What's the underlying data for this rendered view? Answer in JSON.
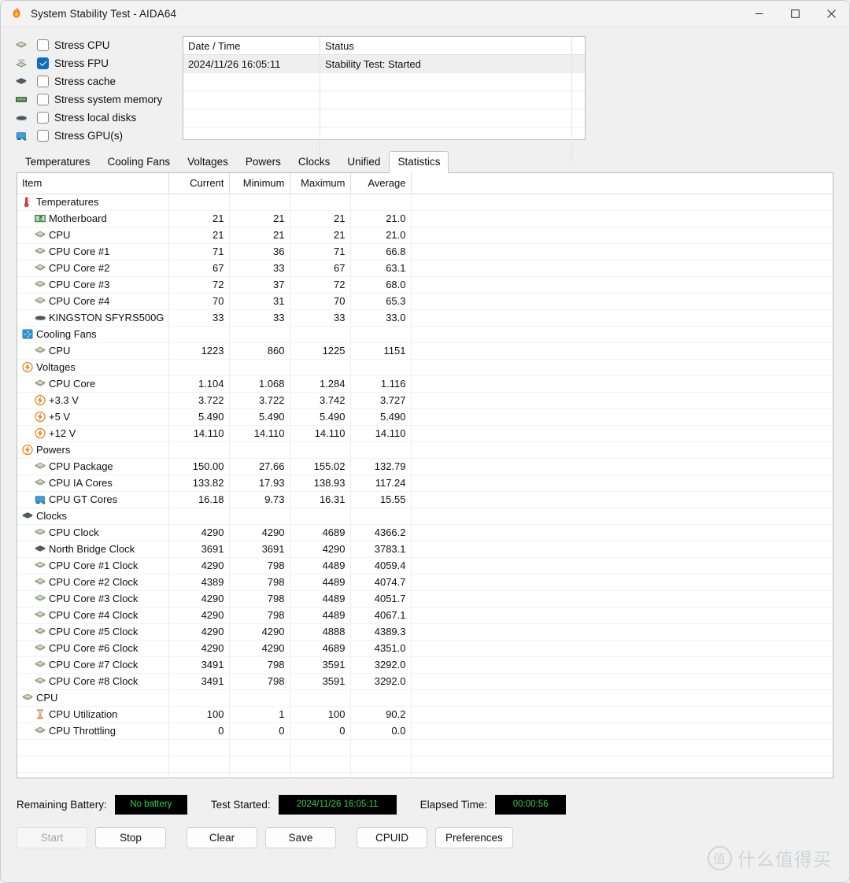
{
  "window": {
    "title": "System Stability Test - AIDA64",
    "app_icon": "flame-icon",
    "minimize_label": "Minimize",
    "maximize_label": "Maximize",
    "close_label": "Close"
  },
  "stress_options": [
    {
      "label": "Stress CPU",
      "checked": false,
      "icon": "cpu-chip-icon"
    },
    {
      "label": "Stress FPU",
      "checked": true,
      "icon": "fpu-chip-icon"
    },
    {
      "label": "Stress cache",
      "checked": false,
      "icon": "cache-chip-icon"
    },
    {
      "label": "Stress system memory",
      "checked": false,
      "icon": "memory-module-icon"
    },
    {
      "label": "Stress local disks",
      "checked": false,
      "icon": "hard-disk-icon"
    },
    {
      "label": "Stress GPU(s)",
      "checked": false,
      "icon": "gpu-monitor-icon"
    }
  ],
  "log": {
    "columns": [
      "Date / Time",
      "Status",
      ""
    ],
    "rows": [
      {
        "datetime": "2024/11/26 16:05:11",
        "status": "Stability Test: Started"
      }
    ]
  },
  "tabs": [
    {
      "label": "Temperatures",
      "active": false
    },
    {
      "label": "Cooling Fans",
      "active": false
    },
    {
      "label": "Voltages",
      "active": false
    },
    {
      "label": "Powers",
      "active": false
    },
    {
      "label": "Clocks",
      "active": false
    },
    {
      "label": "Unified",
      "active": false
    },
    {
      "label": "Statistics",
      "active": true
    }
  ],
  "statistics": {
    "columns": [
      "Item",
      "Current",
      "Minimum",
      "Maximum",
      "Average",
      ""
    ],
    "rows": [
      {
        "type": "group",
        "icon": "thermometer-icon",
        "label": "Temperatures"
      },
      {
        "type": "item",
        "icon": "motherboard-icon",
        "label": "Motherboard",
        "current": "21",
        "minimum": "21",
        "maximum": "21",
        "average": "21.0"
      },
      {
        "type": "item",
        "icon": "cpu-chip-icon",
        "label": "CPU",
        "current": "21",
        "minimum": "21",
        "maximum": "21",
        "average": "21.0"
      },
      {
        "type": "item",
        "icon": "cpu-chip-icon",
        "label": "CPU Core #1",
        "current": "71",
        "minimum": "36",
        "maximum": "71",
        "average": "66.8"
      },
      {
        "type": "item",
        "icon": "cpu-chip-icon",
        "label": "CPU Core #2",
        "current": "67",
        "minimum": "33",
        "maximum": "67",
        "average": "63.1"
      },
      {
        "type": "item",
        "icon": "cpu-chip-icon",
        "label": "CPU Core #3",
        "current": "72",
        "minimum": "37",
        "maximum": "72",
        "average": "68.0"
      },
      {
        "type": "item",
        "icon": "cpu-chip-icon",
        "label": "CPU Core #4",
        "current": "70",
        "minimum": "31",
        "maximum": "70",
        "average": "65.3"
      },
      {
        "type": "item",
        "icon": "hard-disk-icon",
        "label": "KINGSTON SFYRS500G",
        "current": "33",
        "minimum": "33",
        "maximum": "33",
        "average": "33.0"
      },
      {
        "type": "group",
        "icon": "fan-icon",
        "label": "Cooling Fans"
      },
      {
        "type": "item",
        "icon": "cpu-chip-icon",
        "label": "CPU",
        "current": "1223",
        "minimum": "860",
        "maximum": "1225",
        "average": "1151"
      },
      {
        "type": "group",
        "icon": "bolt-icon",
        "label": "Voltages"
      },
      {
        "type": "item",
        "icon": "cpu-chip-icon",
        "label": "CPU Core",
        "current": "1.104",
        "minimum": "1.068",
        "maximum": "1.284",
        "average": "1.116"
      },
      {
        "type": "item",
        "icon": "bolt-icon",
        "label": "+3.3 V",
        "current": "3.722",
        "minimum": "3.722",
        "maximum": "3.742",
        "average": "3.727"
      },
      {
        "type": "item",
        "icon": "bolt-icon",
        "label": "+5 V",
        "current": "5.490",
        "minimum": "5.490",
        "maximum": "5.490",
        "average": "5.490"
      },
      {
        "type": "item",
        "icon": "bolt-icon",
        "label": "+12 V",
        "current": "14.110",
        "minimum": "14.110",
        "maximum": "14.110",
        "average": "14.110"
      },
      {
        "type": "group",
        "icon": "bolt-icon",
        "label": "Powers"
      },
      {
        "type": "item",
        "icon": "cpu-chip-icon",
        "label": "CPU Package",
        "current": "150.00",
        "minimum": "27.66",
        "maximum": "155.02",
        "average": "132.79"
      },
      {
        "type": "item",
        "icon": "cpu-chip-icon",
        "label": "CPU IA Cores",
        "current": "133.82",
        "minimum": "17.93",
        "maximum": "138.93",
        "average": "117.24"
      },
      {
        "type": "item",
        "icon": "gpu-monitor-icon",
        "label": "CPU GT Cores",
        "current": "16.18",
        "minimum": "9.73",
        "maximum": "16.31",
        "average": "15.55"
      },
      {
        "type": "group",
        "icon": "cache-chip-icon",
        "label": "Clocks"
      },
      {
        "type": "item",
        "icon": "cpu-chip-icon",
        "label": "CPU Clock",
        "current": "4290",
        "minimum": "4290",
        "maximum": "4689",
        "average": "4366.2"
      },
      {
        "type": "item",
        "icon": "cache-chip-icon",
        "label": "North Bridge Clock",
        "current": "3691",
        "minimum": "3691",
        "maximum": "4290",
        "average": "3783.1"
      },
      {
        "type": "item",
        "icon": "cpu-chip-icon",
        "label": "CPU Core #1 Clock",
        "current": "4290",
        "minimum": "798",
        "maximum": "4489",
        "average": "4059.4"
      },
      {
        "type": "item",
        "icon": "cpu-chip-icon",
        "label": "CPU Core #2 Clock",
        "current": "4389",
        "minimum": "798",
        "maximum": "4489",
        "average": "4074.7"
      },
      {
        "type": "item",
        "icon": "cpu-chip-icon",
        "label": "CPU Core #3 Clock",
        "current": "4290",
        "minimum": "798",
        "maximum": "4489",
        "average": "4051.7"
      },
      {
        "type": "item",
        "icon": "cpu-chip-icon",
        "label": "CPU Core #4 Clock",
        "current": "4290",
        "minimum": "798",
        "maximum": "4489",
        "average": "4067.1"
      },
      {
        "type": "item",
        "icon": "cpu-chip-icon",
        "label": "CPU Core #5 Clock",
        "current": "4290",
        "minimum": "4290",
        "maximum": "4888",
        "average": "4389.3"
      },
      {
        "type": "item",
        "icon": "cpu-chip-icon",
        "label": "CPU Core #6 Clock",
        "current": "4290",
        "minimum": "4290",
        "maximum": "4689",
        "average": "4351.0"
      },
      {
        "type": "item",
        "icon": "cpu-chip-icon",
        "label": "CPU Core #7 Clock",
        "current": "3491",
        "minimum": "798",
        "maximum": "3591",
        "average": "3292.0"
      },
      {
        "type": "item",
        "icon": "cpu-chip-icon",
        "label": "CPU Core #8 Clock",
        "current": "3491",
        "minimum": "798",
        "maximum": "3591",
        "average": "3292.0"
      },
      {
        "type": "group",
        "icon": "cpu-chip-icon",
        "label": "CPU"
      },
      {
        "type": "item",
        "icon": "hourglass-icon",
        "label": "CPU Utilization",
        "current": "100",
        "minimum": "1",
        "maximum": "100",
        "average": "90.2"
      },
      {
        "type": "item",
        "icon": "cpu-chip-icon",
        "label": "CPU Throttling",
        "current": "0",
        "minimum": "0",
        "maximum": "0",
        "average": "0.0"
      }
    ]
  },
  "status_bar": {
    "battery_label": "Remaining Battery:",
    "battery_value": "No battery",
    "started_label": "Test Started:",
    "started_value": "2024/11/26 16:05:11",
    "elapsed_label": "Elapsed Time:",
    "elapsed_value": "00:00:56",
    "value_text_color": "#2fd142",
    "value_bg_color": "#000000"
  },
  "buttons": {
    "start": "Start",
    "stop": "Stop",
    "clear": "Clear",
    "save": "Save",
    "cpuid": "CPUID",
    "preferences": "Preferences"
  },
  "watermark": {
    "mark": "值",
    "text": "什么值得买"
  }
}
